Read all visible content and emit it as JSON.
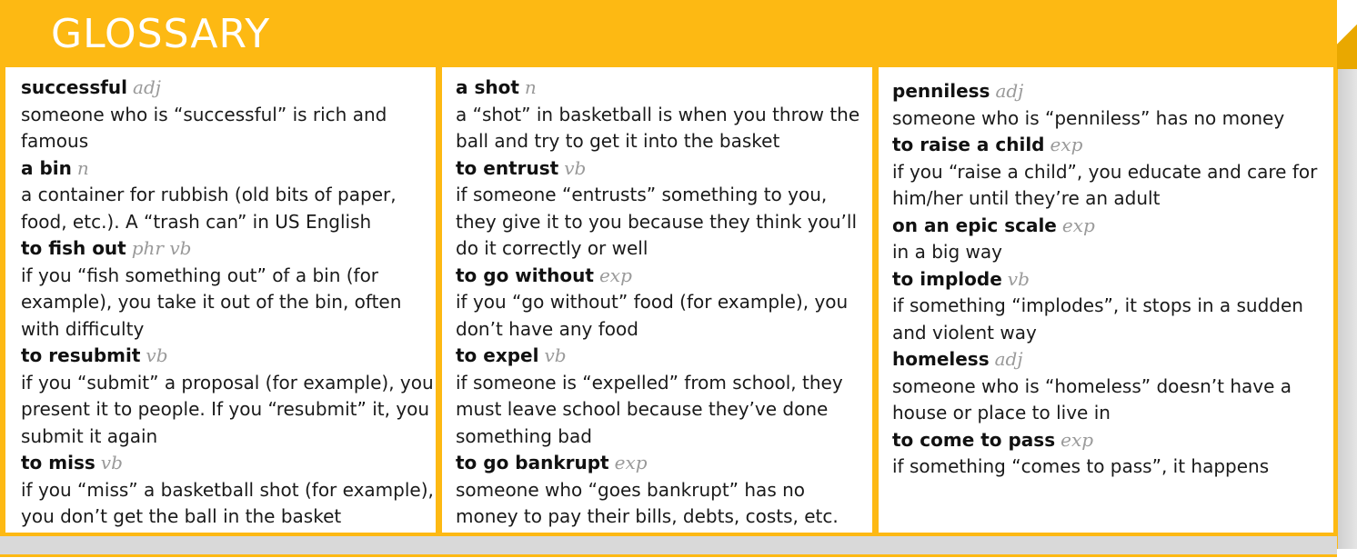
{
  "header": {
    "title": "GLOSSARY"
  },
  "colors": {
    "accent": "#FDB913",
    "term": "#111111",
    "pos": "#9a9a9a"
  },
  "columns": [
    {
      "entries": [
        {
          "term": "successful",
          "pos": "adj",
          "definition": "someone who is “successful” is rich and famous"
        },
        {
          "term": "a bin",
          "pos": "n",
          "definition": "a container for rubbish (old bits of paper, food, etc.). A “trash can” in US English"
        },
        {
          "term": "to fish out",
          "pos": "phr vb",
          "definition": "if you “fish something out” of a bin (for example), you take it out of the bin, often with difficulty"
        },
        {
          "term": "to resubmit",
          "pos": "vb",
          "definition": "if you “submit” a proposal (for example), you present it to people. If you “resubmit” it, you submit it again"
        },
        {
          "term": "to miss",
          "pos": "vb",
          "definition": "if you “miss” a basketball shot (for example), you don’t get the ball in the basket"
        }
      ]
    },
    {
      "entries": [
        {
          "term": "a shot",
          "pos": "n",
          "definition": "a “shot” in basketball is when you throw the ball and try to get it into the basket"
        },
        {
          "term": "to entrust",
          "pos": "vb",
          "definition": "if someone “entrusts” something to you, they give it to you because they think you’ll do it correctly or well"
        },
        {
          "term": "to go without",
          "pos": "exp",
          "definition": "if you “go without” food (for example), you don’t have any food"
        },
        {
          "term": "to expel",
          "pos": "vb",
          "definition": "if someone is “expelled” from school, they must leave school because they’ve done something bad"
        },
        {
          "term": "to go bankrupt",
          "pos": "exp",
          "definition": "someone who “goes bankrupt” has no money to pay their bills, debts, costs, etc."
        }
      ]
    },
    {
      "entries": [
        {
          "term": "penniless",
          "pos": "adj",
          "definition": "someone who is “penniless” has no money"
        },
        {
          "term": "to raise a child",
          "pos": "exp",
          "definition": "if you “raise a child”, you educate and care for him/her until they’re an adult"
        },
        {
          "term": "on an epic scale",
          "pos": "exp",
          "definition": "in a big way"
        },
        {
          "term": "to implode",
          "pos": "vb",
          "definition": "if something “implodes”, it stops in a sudden and violent way"
        },
        {
          "term": "homeless",
          "pos": "adj",
          "definition": "someone who is “homeless” doesn’t have a house or place to live in"
        },
        {
          "term": "to come to pass",
          "pos": "exp",
          "definition": "if something “comes to pass”, it happens"
        }
      ]
    }
  ]
}
